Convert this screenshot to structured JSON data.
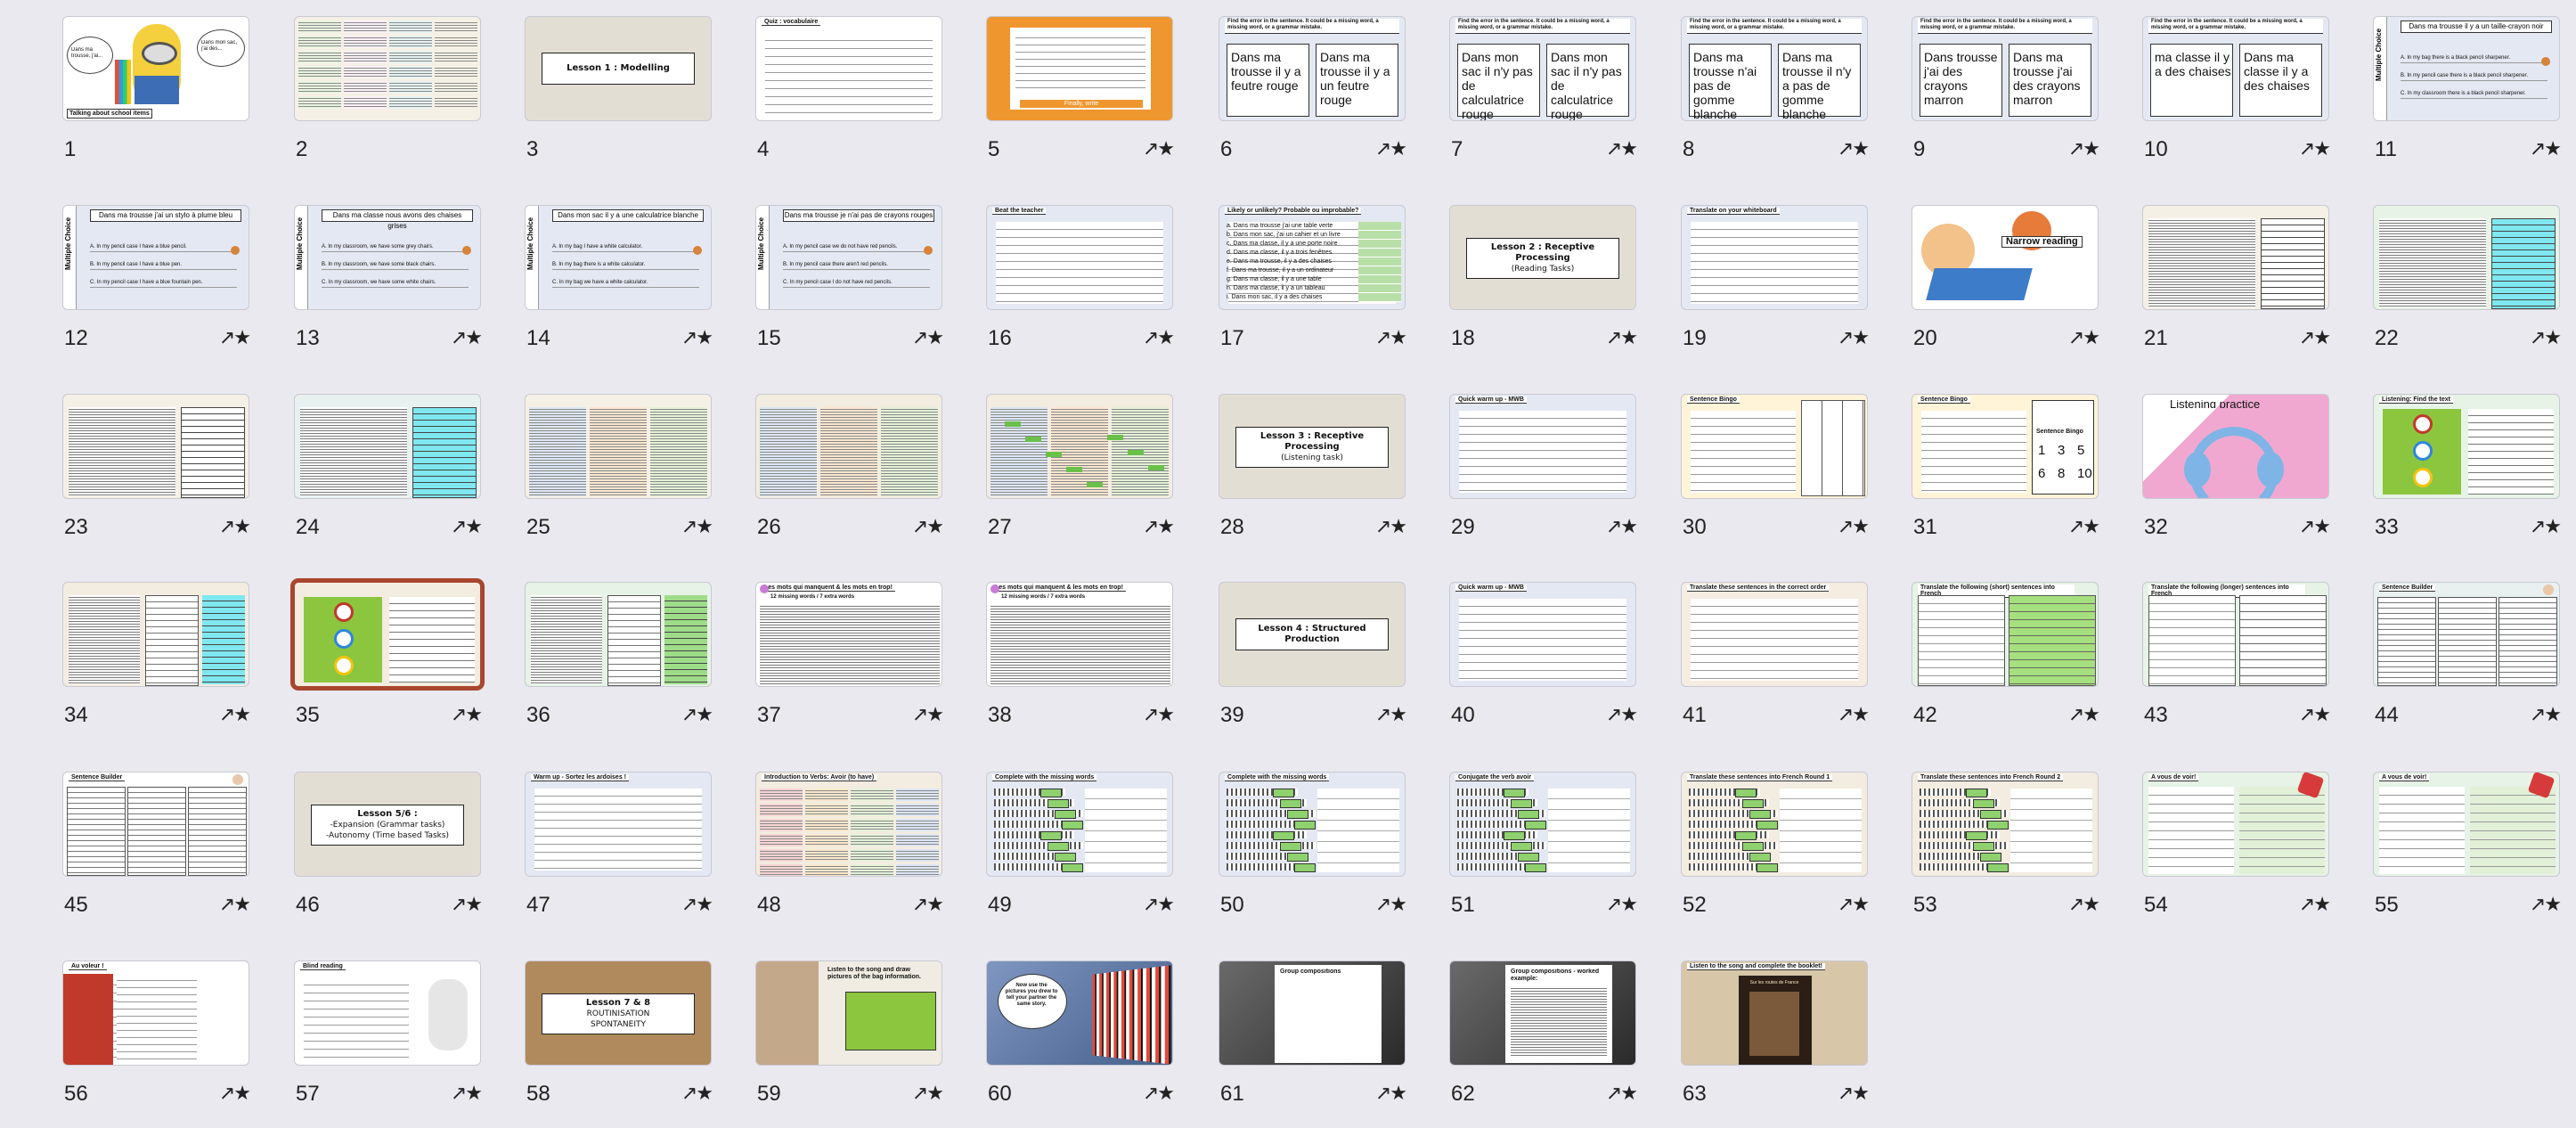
{
  "slides": [
    {
      "n": "1",
      "kind": "minion",
      "title": "Talking about school items",
      "bubble_left": "Dans ma trousse, j'ai...",
      "bubble_right": "Dans mon sac, j'ai des..."
    },
    {
      "n": "2",
      "kind": "table",
      "bg": "#f5f0e6"
    },
    {
      "n": "3",
      "kind": "lesson",
      "bg": "#e3ded4",
      "text": "Lesson 1 : Modelling"
    },
    {
      "n": "4",
      "kind": "list",
      "bg": "#ffffff",
      "header": "Quiz : vocabulaire"
    },
    {
      "n": "5",
      "kind": "orange",
      "bg": "#f0962e",
      "footer": "Finally, write"
    },
    {
      "n": "6",
      "kind": "twobox",
      "bg": "#e4e8f2",
      "header": "Find the error in the sentence. It could be a missing word, a missing word, or a grammar mistake.",
      "a": "Dans ma trousse il y a feutre rouge",
      "b": "Dans ma trousse il y a un feutre rouge"
    },
    {
      "n": "7",
      "kind": "twobox",
      "bg": "#e4e8f2",
      "header": "Find the error in the sentence. It could be a missing word, a missing word, or a grammar mistake.",
      "a": "Dans mon sac il n'y pas de calculatrice rouge",
      "b": "Dans mon sac il n'y pas de calculatrice rouge"
    },
    {
      "n": "8",
      "kind": "twobox",
      "bg": "#e4e8f2",
      "header": "Find the error in the sentence. It could be a missing word, a missing word, or a grammar mistake.",
      "a": "Dans ma trousse n'ai pas de gomme blanche",
      "b": "Dans ma trousse il n'y a pas de gomme blanche"
    },
    {
      "n": "9",
      "kind": "twobox",
      "bg": "#e4e8f2",
      "header": "Find the error in the sentence. It could be a missing word, a missing word, or a grammar mistake.",
      "a": "Dans trousse j'ai des crayons marron",
      "b": "Dans ma trousse j'ai des crayons marron"
    },
    {
      "n": "10",
      "kind": "twobox",
      "bg": "#e4e8f2",
      "header": "Find the error in the sentence. It could be a missing word, a missing word, or a grammar mistake.",
      "a": "ma classe il y a des chaises",
      "b": "Dans ma classe il y a des chaises"
    },
    {
      "n": "11",
      "kind": "mc",
      "bg": "#e4e8f2",
      "header": "Dans ma trousse il y a un taille-crayon noir",
      "side": "Multiple Choice",
      "opts": [
        "A. In my bag there is a black pencil sharpener.",
        "B. In my pencil case there is a black pencil sharpener.",
        "C. In my classroom there is a black pencil sharpener."
      ]
    },
    {
      "n": "12",
      "kind": "mc",
      "bg": "#e4e8f2",
      "header": "Dans ma trousse j'ai un stylo à plume bleu",
      "side": "Multiple Choice",
      "opts": [
        "A. In my pencil case I have a blue pencil.",
        "B. In my pencil case I have a blue pen.",
        "C. In my pencil case I have a blue fountain pen."
      ]
    },
    {
      "n": "13",
      "kind": "mc",
      "bg": "#e4e8f2",
      "header": "Dans ma classe nous avons des chaises grises",
      "side": "Multiple Choice",
      "opts": [
        "A. In my classroom, we have some grey chairs.",
        "B. In my classroom, we have some black chairs.",
        "C. In my classroom, we have some white chairs."
      ]
    },
    {
      "n": "14",
      "kind": "mc",
      "bg": "#e4e8f2",
      "header": "Dans mon sac il y a une calculatrice blanche",
      "side": "Multiple Choice",
      "opts": [
        "A. In my bag I have a white calculator.",
        "B. In my bag there is a white calculator.",
        "C. In my bag we have a white calculator."
      ]
    },
    {
      "n": "15",
      "kind": "mc",
      "bg": "#e4e8f2",
      "header": "Dans ma trousse je n'ai pas de crayons rouges",
      "side": "Multiple Choice",
      "opts": [
        "A. In my pencil case we do not have red pencils.",
        "B. In my pencil case there aren't red pencils.",
        "C. In my pencil case I do not have red pencils."
      ]
    },
    {
      "n": "16",
      "kind": "list",
      "bg": "#e4e8f2",
      "header": "Beat the teacher"
    },
    {
      "n": "17",
      "kind": "probable",
      "bg": "#e4e8f2",
      "header": "Likely or unlikely? Probable ou improbable?",
      "opts": [
        "a. Dans ma trousse j'ai une table verte",
        "b. Dans mon sac, j'ai un cahier et un livre",
        "c. Dans ma classe, il y a une porte noire",
        "d. Dans ma classe, il y a trois fenêtres",
        "e. Dans ma trousse, il y a des chaises",
        "f. Dans ma trousse, il y a un ordinateur",
        "g. Dans ma classe, il y a une table",
        "h. Dans ma classe, il y a un tableau",
        "i. Dans mon sac, il y a des chaises"
      ]
    },
    {
      "n": "18",
      "kind": "lesson",
      "bg": "#e3ded4",
      "text": "Lesson 2 : Receptive Processing",
      "sub": "(Reading Tasks)"
    },
    {
      "n": "19",
      "kind": "list",
      "bg": "#e4e8f2",
      "header": "Translate on your whiteboard"
    },
    {
      "n": "20",
      "kind": "kids",
      "bg": "#ffffff",
      "title": "Narrow reading"
    },
    {
      "n": "21",
      "kind": "reading",
      "bg": "#f5f0e6"
    },
    {
      "n": "22",
      "kind": "reading2",
      "bg": "#e6f3e6"
    },
    {
      "n": "23",
      "kind": "reading",
      "bg": "#f5f0e6"
    },
    {
      "n": "24",
      "kind": "reading2",
      "bg": "#e8f0f0"
    },
    {
      "n": "25",
      "kind": "cols",
      "bg": "#f5f0e6"
    },
    {
      "n": "26",
      "kind": "cols",
      "bg": "#f3ece0"
    },
    {
      "n": "27",
      "kind": "cols2",
      "bg": "#f3ece0"
    },
    {
      "n": "28",
      "kind": "lesson",
      "bg": "#e3ded4",
      "text": "Lesson 3 : Receptive Processing",
      "sub": "(Listening task)"
    },
    {
      "n": "29",
      "kind": "list",
      "bg": "#e4e8f2",
      "header": "Quick warm up - MWB"
    },
    {
      "n": "30",
      "kind": "sentence",
      "bg": "#fff4d8",
      "header": "Sentence Bingo"
    },
    {
      "n": "31",
      "kind": "bingo",
      "bg": "#fff4d8",
      "header": "Sentence Bingo",
      "nums": [
        "1",
        "3",
        "5",
        "6",
        "8",
        "10"
      ]
    },
    {
      "n": "32",
      "kind": "headphones",
      "bg": "#f2b8d8",
      "title": "Listening practice"
    },
    {
      "n": "33",
      "kind": "audio",
      "bg": "#e6f3e6",
      "header": "Listening: Find the text"
    },
    {
      "n": "34",
      "kind": "cyan",
      "bg": "#f3ece0"
    },
    {
      "n": "35",
      "kind": "audio2",
      "bg": "#f3ece0"
    },
    {
      "n": "36",
      "kind": "cyan2",
      "bg": "#e6f3e6"
    },
    {
      "n": "37",
      "kind": "para",
      "bg": "#ffffff",
      "header": "Les mots qui manquent & les mots en trop!",
      "sub": "12 missing words / 7 extra words"
    },
    {
      "n": "38",
      "kind": "para",
      "bg": "#ffffff",
      "header": "Les mots qui manquent & les mots en trop!",
      "sub": "12 missing words / 7 extra words"
    },
    {
      "n": "39",
      "kind": "lesson",
      "bg": "#e3ded4",
      "text": "Lesson 4 : Structured Production"
    },
    {
      "n": "40",
      "kind": "list",
      "bg": "#e4e8f2",
      "header": "Quick warm up - MWB"
    },
    {
      "n": "41",
      "kind": "order",
      "bg": "#f5ece2",
      "header": "Translate these sentences in the correct order"
    },
    {
      "n": "42",
      "kind": "green",
      "bg": "#e6f3e6",
      "header": "Translate the following (short) sentences into French"
    },
    {
      "n": "43",
      "kind": "green2",
      "bg": "#e6f3e6",
      "header": "Translate the following (longer) sentences into French"
    },
    {
      "n": "44",
      "kind": "table3",
      "bg": "#e8f0f0",
      "header": "Sentence Builder"
    },
    {
      "n": "45",
      "kind": "table3",
      "bg": "#ffffff",
      "header": "Sentence Builder"
    },
    {
      "n": "46",
      "kind": "lesson",
      "bg": "#e3ded4",
      "text": "Lesson 5/6 :",
      "sub": "-Expansion (Grammar tasks)\n-Autonomy (Time based Tasks)"
    },
    {
      "n": "47",
      "kind": "list",
      "bg": "#e4e8f2",
      "header": "Warm up - Sortez les ardoises !"
    },
    {
      "n": "48",
      "kind": "verbs",
      "bg": "#f3ece0",
      "header": "Introduction to Verbs: Avoir (to have)"
    },
    {
      "n": "49",
      "kind": "fill",
      "bg": "#e4e8f2",
      "header": "Complete with the missing words"
    },
    {
      "n": "50",
      "kind": "fill",
      "bg": "#e4e8f2",
      "header": "Complete with the missing words"
    },
    {
      "n": "51",
      "kind": "fill",
      "bg": "#e4e8f2",
      "header": "Conjugate the verb avoir"
    },
    {
      "n": "52",
      "kind": "fill",
      "bg": "#f3ece0",
      "header": "Translate these sentences into French Round 1"
    },
    {
      "n": "53",
      "kind": "fill",
      "bg": "#f3ece0",
      "header": "Translate these sentences into French Round 2"
    },
    {
      "n": "54",
      "kind": "dice",
      "bg": "#e6f3e6",
      "header": "A vous de voir!"
    },
    {
      "n": "55",
      "kind": "dice",
      "bg": "#e6f3e6",
      "header": "A vous de voir!"
    },
    {
      "n": "56",
      "kind": "vrai",
      "bg": "#e4e8f2",
      "header": "Au voleur !"
    },
    {
      "n": "57",
      "kind": "robot",
      "bg": "#ffffff",
      "header": "Blind reading"
    },
    {
      "n": "58",
      "kind": "lesson",
      "bg": "#b08a5c",
      "text": "Lesson 7 & 8",
      "sub": "ROUTINISATION\nSPONTANEITY"
    },
    {
      "n": "59",
      "kind": "draw",
      "bg": "#f0ece4",
      "header": "Listen to the song and draw pictures of the bag information."
    },
    {
      "n": "60",
      "kind": "books",
      "bg": "#6a86b0",
      "bubble": "Now use the pictures you drew to tell your partner the same story."
    },
    {
      "n": "61",
      "kind": "group",
      "bg": "#4a4a4a",
      "header": "Group compositions"
    },
    {
      "n": "62",
      "kind": "group",
      "bg": "#4a4a4a",
      "header": "Group compositions - worked example:"
    },
    {
      "n": "63",
      "kind": "song",
      "bg": "#d7c6a8",
      "header": "Listen to the song and complete the booklet!",
      "title": "Sur les routes de France"
    }
  ]
}
